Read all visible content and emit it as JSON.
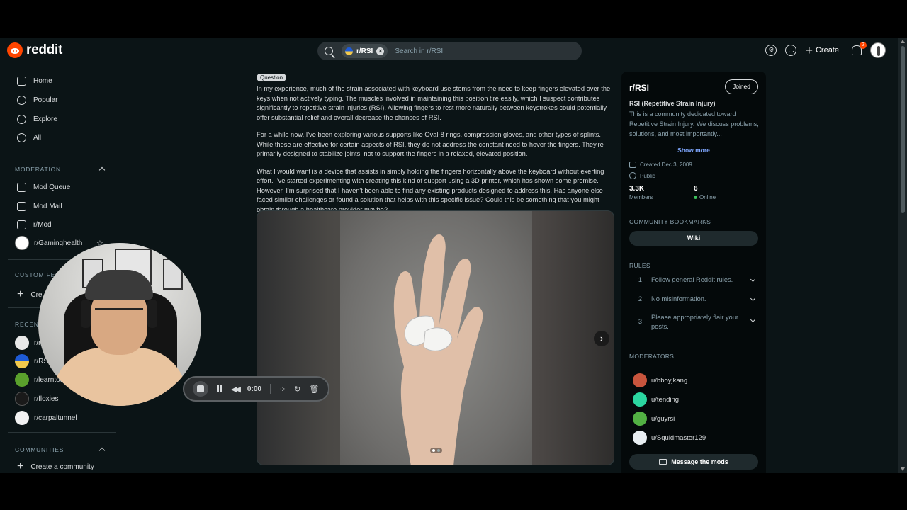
{
  "header": {
    "logo_text": "reddit",
    "search_chip": "r/RSI",
    "search_placeholder": "Search in r/RSI",
    "create_label": "Create",
    "notification_count": "2"
  },
  "sidebar": {
    "nav": [
      {
        "label": "Home",
        "icon": "home-icon"
      },
      {
        "label": "Popular",
        "icon": "popular-icon"
      },
      {
        "label": "Explore",
        "icon": "explore-icon"
      },
      {
        "label": "All",
        "icon": "all-icon"
      }
    ],
    "moderation_title": "MODERATION",
    "moderation": [
      {
        "label": "Mod Queue",
        "icon": "mod-queue-icon"
      },
      {
        "label": "Mod Mail",
        "icon": "mod-mail-icon"
      },
      {
        "label": "r/Mod",
        "icon": "mod-icon"
      },
      {
        "label": "r/Gaminghealth",
        "icon": "gaminghealth-avatar"
      }
    ],
    "custom_feeds_title": "CUSTOM FEE",
    "create_feed": "Cre",
    "recent_title": "RECENT",
    "recent": [
      {
        "label": "r/r",
        "color": "#e8e8e8"
      },
      {
        "label": "r/RSI",
        "color": "#1e5bd6"
      },
      {
        "label": "r/learntod",
        "color": "#5aa02c"
      },
      {
        "label": "r/floxies",
        "color": "#1a1a1a"
      },
      {
        "label": "r/carpaltunnel",
        "color": "#f2f2f2"
      }
    ],
    "communities_title": "COMMUNITIES",
    "create_community": "Create a community"
  },
  "recorder": {
    "time": "0:00"
  },
  "post": {
    "flair": "Question",
    "paragraphs": [
      "In my experience, much of the strain associated with keyboard use stems from the need to keep fingers elevated over the keys when not actively typing. The muscles involved in maintaining this position tire easily, which I suspect contributes significantly to repetitive strain injuries (RSI). Allowing fingers to rest more naturally between keystrokes could potentially offer substantial relief and overall decrease the chanses of RSI.",
      "For a while now, I've been exploring various supports like Oval-8 rings, compression gloves, and other types of splints. While these are effective for certain aspects of RSI, they do not address the constant need to hover the fingers. They're primarily designed to stabilize joints, not to support the fingers in a relaxed, elevated position.",
      "What I would want is a device that assists in simply holding the fingers horizontally above the keyboard without exerting effort. I've started experimenting with creating this kind of support using a 3D printer, which has shown some promise. However, I'm surprised that I haven't been able to find any existing products designed to address this. Has anyone else faced similar challenges or found a solution that helps with this specific issue? Could this be something that you might obtain through a healthcare provider maybe?"
    ],
    "gallery_index": 1,
    "gallery_count": 2
  },
  "community": {
    "name": "r/RSI",
    "joined_label": "Joined",
    "title": "RSI (Repetitive Strain Injury)",
    "description": "This is a community dedicated toward Repetitive Strain Injury. We discuss problems, solutions, and most importantly...",
    "show_more": "Show more",
    "created": "Created Dec 3, 2009",
    "visibility": "Public",
    "members_count": "3.3K",
    "members_label": "Members",
    "online_count": "6",
    "online_label": "Online",
    "bookmarks_title": "COMMUNITY BOOKMARKS",
    "wiki_label": "Wiki",
    "rules_title": "RULES",
    "rules": [
      {
        "num": "1",
        "text": "Follow general Reddit rules."
      },
      {
        "num": "2",
        "text": "No misinformation."
      },
      {
        "num": "3",
        "text": "Please appropriately flair your posts."
      }
    ],
    "moderators_title": "MODERATORS",
    "moderators": [
      {
        "name": "u/bboyjkang",
        "color": "#c8553d"
      },
      {
        "name": "u/tending",
        "color": "#2bd6a0"
      },
      {
        "name": "u/guyrsi",
        "color": "#52b043"
      },
      {
        "name": "u/Squidmaster129",
        "color": "#e8eef2"
      }
    ],
    "message_mods": "Message the mods"
  }
}
